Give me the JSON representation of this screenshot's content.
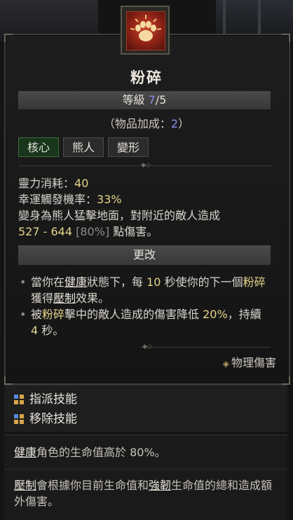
{
  "skill": {
    "name": "粉碎",
    "rank_prefix": "等級 ",
    "rank_current": "7",
    "rank_max": "/5",
    "bonus_prefix": "（物品加成：",
    "bonus_value": "2",
    "bonus_suffix": "）",
    "tags": [
      "核心",
      "熊人",
      "變形"
    ]
  },
  "stats": {
    "spirit_cost_label": "靈力消耗：",
    "spirit_cost_value": "40",
    "lucky_hit_label": "幸運觸發機率：",
    "lucky_hit_value": "33%",
    "description": "變身為熊人猛擊地面，對附近的敵人造成",
    "damage_range": "527 - 644",
    "damage_pct": "[80%]",
    "damage_suffix": " 點傷害。"
  },
  "changes": {
    "header": "更改",
    "bullet1": {
      "p1": "當你在",
      "kw1": "健康",
      "p2": "狀態下，每 ",
      "hl1": "10",
      "p3": " 秒使你的下一個",
      "kw2": "粉碎",
      "p4": "獲得",
      "kw3": "壓制",
      "p5": "效果。"
    },
    "bullet2": {
      "p1": "被",
      "kw1": "粉碎",
      "p2": "擊中的敵人造成的傷害降低 ",
      "hl1": "20%",
      "p3": "，持續 ",
      "hl2": "4",
      "p4": " 秒。"
    }
  },
  "damage_type": "物理傷害",
  "actions": {
    "assign": "指派技能",
    "remove": "移除技能"
  },
  "glossary": {
    "healthy_term": "健康",
    "healthy_desc": "角色的生命值高於 80%。",
    "overpower_term": "壓制",
    "overpower_p1": "會根據你目前生命值和",
    "fortify_term": "強韌",
    "overpower_p2": "生命值的總和造成額外傷害。"
  },
  "colors": {
    "rank": "#8f8cf0",
    "highlight": "#e3d48a",
    "core_tag": "#17361b"
  }
}
